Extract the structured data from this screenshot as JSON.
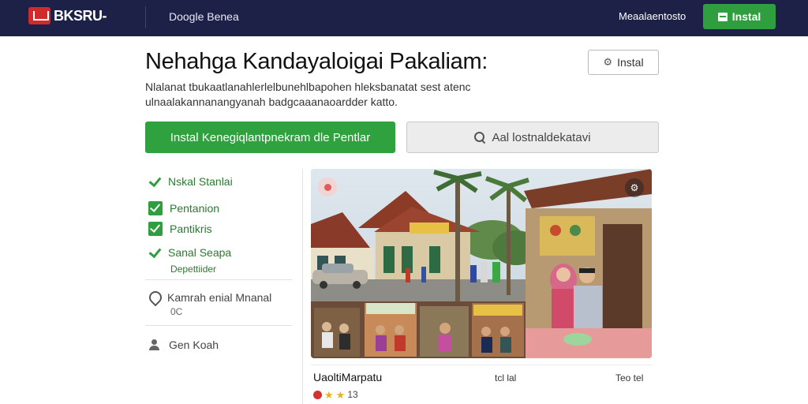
{
  "header": {
    "logo_text": "BKSRU-",
    "nav_link": "Doogle Benea",
    "right_link": "Meaalaentosto",
    "install_button": "Instal",
    "brand_color": "#1d2147",
    "accent_color": "#2f9e3e"
  },
  "main": {
    "title": "Nehahga Kandayaloigai Pakaliam:",
    "install_outline_button": "Instal",
    "description_line1": "Nlalanat tbukaatlanahlerlelbunehlbapohen hleksbanatat sest atenc",
    "description_line2": "ulnaalakannanangyanah badgcaaanaoardder katto.",
    "primary_button": "Instal Kenegiqlantpnekram dle Pentlar",
    "search_button": "Aal lostnaldekatavi"
  },
  "checklist": {
    "items": [
      {
        "label": "Nskal Stanlai",
        "style": "tick"
      },
      {
        "label": "Pentanion",
        "style": "box"
      },
      {
        "label": "Pantikris",
        "style": "box"
      },
      {
        "label": "Sanal Seapa",
        "style": "tick",
        "sub": "Depettiider"
      }
    ],
    "location_label": "Kamrah enial Mnanal",
    "location_sub": "0C",
    "host_label": "Gen Koah",
    "icons": [
      "check-icon",
      "checkbox-icon",
      "location-pin-icon",
      "person-icon"
    ]
  },
  "card": {
    "title": "UaoltiMarpatu",
    "mid_text": "tcl lal",
    "right_text": "Teo tel",
    "rating_text": "13",
    "stars": 2
  }
}
